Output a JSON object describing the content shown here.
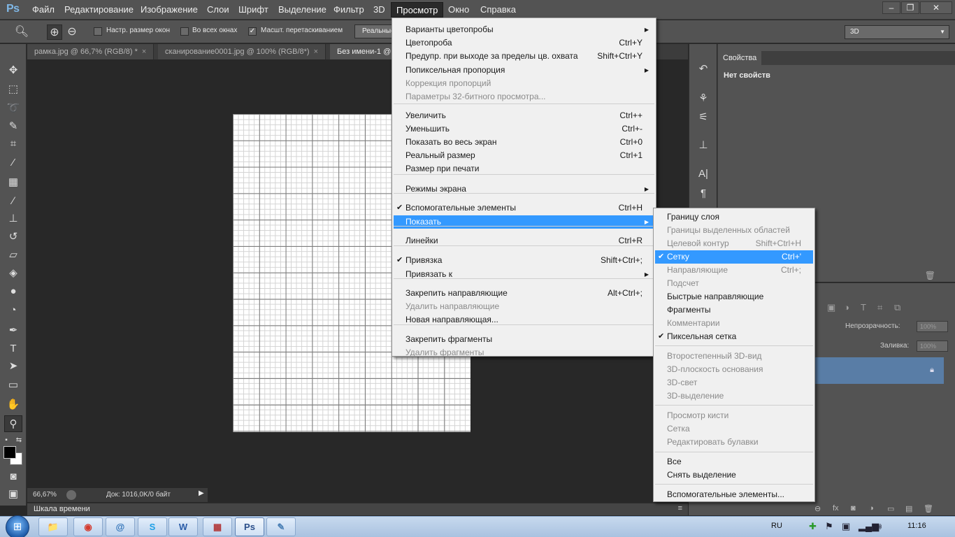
{
  "app": {
    "logo": "Ps"
  },
  "menubar": {
    "items": [
      "Файл",
      "Редактирование",
      "Изображение",
      "Слои",
      "Шрифт",
      "Выделение",
      "Фильтр",
      "3D",
      "Просмотр",
      "Окно",
      "Справка"
    ],
    "window_controls": [
      "–",
      "❐",
      "✕"
    ]
  },
  "options": {
    "check1_label": "Настр. размер окон",
    "check2_label": "Во всех окнах",
    "check3_label": "Масшт. перетаскиванием",
    "actual_pixels_button": "Реальные",
    "workspace": "3D"
  },
  "tabs": [
    {
      "label": "рамка.jpg @ 66,7% (RGB/8) *"
    },
    {
      "label": "сканирование0001.jpg @ 100% (RGB/8*)"
    },
    {
      "label": "Без имени-1 @"
    }
  ],
  "status": {
    "zoom": "66,67%",
    "doc": "Док: 1016,0K/0 байт"
  },
  "timeline": {
    "label": "Шкала времени"
  },
  "properties": {
    "tab": "Свойства",
    "content": "Нет свойств"
  },
  "layers": {
    "opacity_label": "Непрозрачность:",
    "opacity_value": "100%",
    "fill_label": "Заливка:",
    "fill_value": "100%"
  },
  "view_menu": {
    "items": [
      {
        "label": "Варианты цветопробы",
        "shortcut": "",
        "submenu": true,
        "disabled": false,
        "checked": false
      },
      {
        "label": "Цветопроба",
        "shortcut": "Ctrl+Y",
        "submenu": false,
        "disabled": false,
        "checked": false
      },
      {
        "label": "Предупр. при выходе за пределы цв. охвата",
        "shortcut": "Shift+Ctrl+Y",
        "submenu": false,
        "disabled": false,
        "checked": false
      },
      {
        "label": "Попиксельная пропорция",
        "shortcut": "",
        "submenu": true,
        "disabled": false,
        "checked": false
      },
      {
        "label": "Коррекция пропорций",
        "shortcut": "",
        "submenu": false,
        "disabled": true,
        "checked": false
      },
      {
        "label": "Параметры 32-битного просмотра...",
        "shortcut": "",
        "submenu": false,
        "disabled": true,
        "checked": false
      },
      {
        "label": "Увеличить",
        "shortcut": "Ctrl++",
        "submenu": false,
        "disabled": false,
        "checked": false
      },
      {
        "label": "Уменьшить",
        "shortcut": "Ctrl+-",
        "submenu": false,
        "disabled": false,
        "checked": false
      },
      {
        "label": "Показать во весь экран",
        "shortcut": "Ctrl+0",
        "submenu": false,
        "disabled": false,
        "checked": false
      },
      {
        "label": "Реальный размер",
        "shortcut": "Ctrl+1",
        "submenu": false,
        "disabled": false,
        "checked": false
      },
      {
        "label": "Размер при печати",
        "shortcut": "",
        "submenu": false,
        "disabled": false,
        "checked": false
      },
      {
        "label": "Режимы экрана",
        "shortcut": "",
        "submenu": true,
        "disabled": false,
        "checked": false
      },
      {
        "label": "Вспомогательные элементы",
        "shortcut": "Ctrl+H",
        "submenu": false,
        "disabled": false,
        "checked": true
      },
      {
        "label": "Показать",
        "shortcut": "",
        "submenu": true,
        "disabled": false,
        "checked": false
      },
      {
        "label": "Линейки",
        "shortcut": "Ctrl+R",
        "submenu": false,
        "disabled": false,
        "checked": false
      },
      {
        "label": "Привязка",
        "shortcut": "Shift+Ctrl+;",
        "submenu": false,
        "disabled": false,
        "checked": true
      },
      {
        "label": "Привязать к",
        "shortcut": "",
        "submenu": true,
        "disabled": false,
        "checked": false
      },
      {
        "label": "Закрепить направляющие",
        "shortcut": "Alt+Ctrl+;",
        "submenu": false,
        "disabled": false,
        "checked": false
      },
      {
        "label": "Удалить направляющие",
        "shortcut": "",
        "submenu": false,
        "disabled": true,
        "checked": false
      },
      {
        "label": "Новая направляющая...",
        "shortcut": "",
        "submenu": false,
        "disabled": false,
        "checked": false
      },
      {
        "label": "Закрепить фрагменты",
        "shortcut": "",
        "submenu": false,
        "disabled": false,
        "checked": false
      },
      {
        "label": "Удалить фрагменты",
        "shortcut": "",
        "submenu": false,
        "disabled": true,
        "checked": false
      }
    ],
    "highlighted": "Показать"
  },
  "show_menu": {
    "items": [
      {
        "label": "Границу слоя",
        "shortcut": "",
        "disabled": false,
        "checked": false
      },
      {
        "label": "Границы выделенных областей",
        "shortcut": "",
        "disabled": true,
        "checked": false
      },
      {
        "label": "Целевой контур",
        "shortcut": "Shift+Ctrl+H",
        "disabled": true,
        "checked": false
      },
      {
        "label": "Сетку",
        "shortcut": "Ctrl+'",
        "disabled": false,
        "checked": true
      },
      {
        "label": "Направляющие",
        "shortcut": "Ctrl+;",
        "disabled": true,
        "checked": false
      },
      {
        "label": "Подсчет",
        "shortcut": "",
        "disabled": true,
        "checked": false
      },
      {
        "label": "Быстрые направляющие",
        "shortcut": "",
        "disabled": false,
        "checked": false
      },
      {
        "label": "Фрагменты",
        "shortcut": "",
        "disabled": false,
        "checked": false
      },
      {
        "label": "Комментарии",
        "shortcut": "",
        "disabled": true,
        "checked": false
      },
      {
        "label": "Пиксельная сетка",
        "shortcut": "",
        "disabled": false,
        "checked": true
      },
      {
        "label": "Второстепенный 3D-вид",
        "shortcut": "",
        "disabled": true,
        "checked": false
      },
      {
        "label": "3D-плоскость основания",
        "shortcut": "",
        "disabled": true,
        "checked": false
      },
      {
        "label": "3D-свет",
        "shortcut": "",
        "disabled": true,
        "checked": false
      },
      {
        "label": "3D-выделение",
        "shortcut": "",
        "disabled": true,
        "checked": false
      },
      {
        "label": "Просмотр кисти",
        "shortcut": "",
        "disabled": true,
        "checked": false
      },
      {
        "label": "Сетка",
        "shortcut": "",
        "disabled": true,
        "checked": false
      },
      {
        "label": "Редактировать булавки",
        "shortcut": "",
        "disabled": true,
        "checked": false
      },
      {
        "label": "Все",
        "shortcut": "",
        "disabled": false,
        "checked": false
      },
      {
        "label": "Снять выделение",
        "shortcut": "",
        "disabled": false,
        "checked": false
      },
      {
        "label": "Вспомогательные элементы...",
        "shortcut": "",
        "disabled": false,
        "checked": false
      }
    ],
    "highlighted": "Сетку"
  },
  "taskbar": {
    "apps": [
      "explorer-icon",
      "chrome-icon",
      "network-icon",
      "skype-icon",
      "word-icon",
      "paint-icon",
      "photoshop-icon",
      "paint-app-icon"
    ],
    "app_glyphs": [
      "📁",
      "◉",
      "@",
      "S",
      "W",
      "▦",
      "Ps",
      "✎"
    ],
    "lang": "RU",
    "time": "11:16"
  }
}
